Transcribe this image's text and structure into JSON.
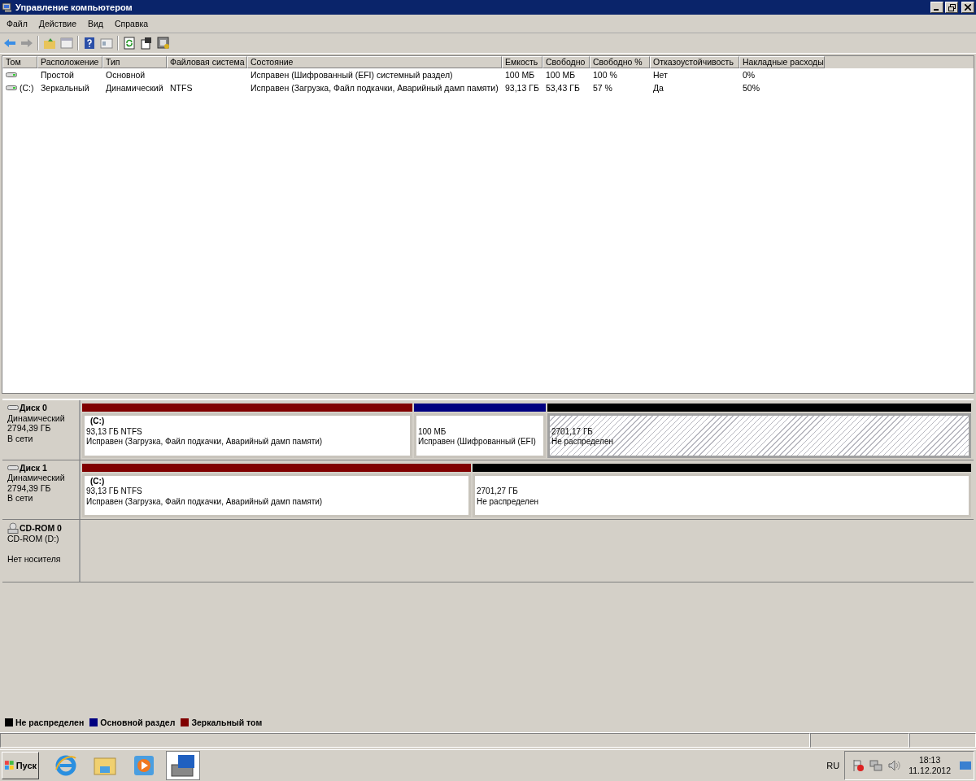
{
  "window": {
    "title": "Управление компьютером"
  },
  "menu": [
    "Файл",
    "Действие",
    "Вид",
    "Справка"
  ],
  "table": {
    "columns": [
      "Том",
      "Расположение",
      "Тип",
      "Файловая система",
      "Состояние",
      "Емкость",
      "Свободно",
      "Свободно %",
      "Отказоустойчивость",
      "Накладные расходы"
    ],
    "rows": [
      [
        "",
        "Простой",
        "Основной",
        "",
        "Исправен (Шифрованный (EFI) системный раздел)",
        "100 МБ",
        "100 МБ",
        "100 %",
        "Нет",
        "0%"
      ],
      [
        "(C:)",
        "Зеркальный",
        "Динамический",
        "NTFS",
        "Исправен (Загрузка, Файл подкачки, Аварийный дамп памяти)",
        "93,13 ГБ",
        "53,43 ГБ",
        "57 %",
        "Да",
        "50%"
      ]
    ]
  },
  "disks": [
    {
      "kind": "disk",
      "name": "Диск 0",
      "type": "Динамический",
      "size": "2794,39 ГБ",
      "status": "В сети",
      "partitions": [
        {
          "kind": "mirror",
          "selected": false,
          "label": "(C:)",
          "lines": [
            "93,13 ГБ NTFS",
            "Исправен (Загрузка, Файл подкачки, Аварийный дамп памяти)"
          ]
        },
        {
          "kind": "primary",
          "selected": false,
          "lines": [
            "100 МБ",
            "Исправен (Шифрованный (EFI)"
          ]
        },
        {
          "kind": "unallocated",
          "selected": true,
          "lines": [
            "2701,17 ГБ",
            "Не распределен"
          ]
        }
      ]
    },
    {
      "kind": "disk",
      "name": "Диск 1",
      "type": "Динамический",
      "size": "2794,39 ГБ",
      "status": "В сети",
      "partitions": [
        {
          "kind": "mirror",
          "selected": false,
          "label": "(C:)",
          "lines": [
            "93,13 ГБ NTFS",
            "Исправен (Загрузка, Файл подкачки, Аварийный дамп памяти)"
          ]
        },
        {
          "kind": "unallocated",
          "selected": false,
          "lines": [
            "2701,27 ГБ",
            "Не распределен"
          ]
        }
      ]
    },
    {
      "kind": "cdrom",
      "name": "CD-ROM 0",
      "type": "CD-ROM (D:)",
      "status": "Нет носителя"
    }
  ],
  "legend": [
    {
      "label": "Не распределен",
      "color": "#000000"
    },
    {
      "label": "Основной раздел",
      "color": "#000080"
    },
    {
      "label": "Зеркальный том",
      "color": "#800000"
    }
  ],
  "taskbar": {
    "start": "Пуск",
    "language": "RU",
    "time": "18:13",
    "date": "11.12.2012"
  }
}
